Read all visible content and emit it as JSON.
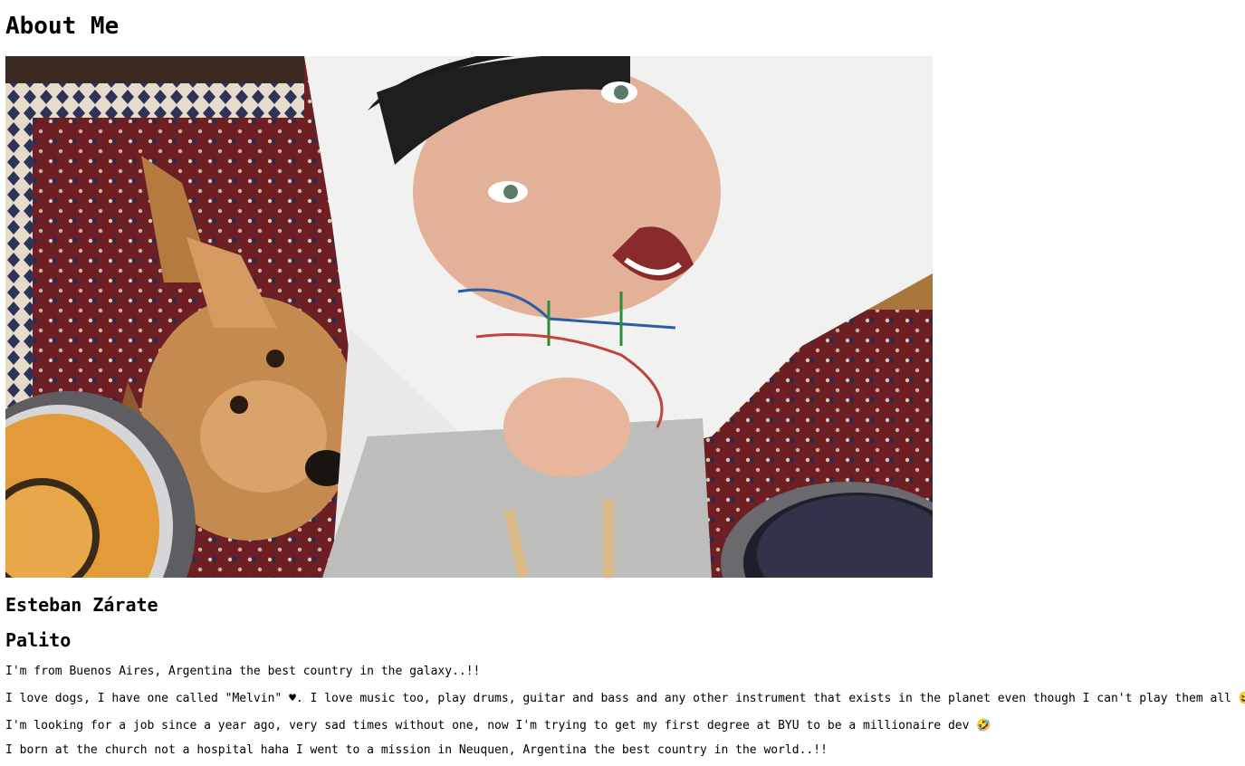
{
  "page": {
    "heading": "About Me",
    "photo_alt": "",
    "name": "Esteban Zárate",
    "nickname": "Palito",
    "bio": [
      "I'm from Buenos Aires, Argentina the best country in the galaxy..!!",
      "I love dogs, I have one called \"Melvin\" ♥. I love music too, play drums, guitar and bass and any other instrument that exists in the planet even though I can't play them all 😆",
      "I'm looking for a job since a year ago, very sad times without one, now I'm trying to get my first degree at BYU to be a millionaire dev 🤣",
      "I born at the church not a hospital haha I went to a mission in Neuquen, Argentina the best country in the world..!!"
    ]
  }
}
